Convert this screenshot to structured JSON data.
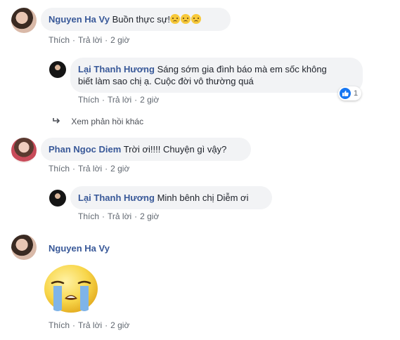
{
  "comments": [
    {
      "author": "Nguyen Ha Vy",
      "text": "Buồn thực sự!",
      "emoji": [
        "sad-face",
        "sad-face",
        "sad-face"
      ],
      "like": "Thích",
      "reply": "Trả lời",
      "time": "2 giờ"
    },
    {
      "author": "Lại Thanh Hương",
      "text_line1": "Sáng sớm gia đình báo mà em sốc không",
      "text_line2": "biết làm sao chị ạ. Cuộc đời vô thường quá",
      "reactions_count": "1",
      "like": "Thích",
      "reply": "Trả lời",
      "time": "2 giờ"
    },
    {
      "author": "Phan Ngoc Diem",
      "text": "Trời ơi!!!! Chuyện gì vậy?",
      "like": "Thích",
      "reply": "Trả lời",
      "time": "2 giờ"
    },
    {
      "author": "Lại Thanh Hương",
      "text": "Minh bênh chị Diễm ơi",
      "like": "Thích",
      "reply": "Trả lời",
      "time": "2 giờ"
    },
    {
      "author": "Nguyen Ha Vy",
      "sticker": "crying-face-sticker",
      "like": "Thích",
      "reply": "Trả lời",
      "time": "2 giờ"
    }
  ],
  "more_replies": "Xem phản hồi khác",
  "colors": {
    "name": "#385898",
    "bubble": "#f2f3f5",
    "meta": "#606770",
    "like": "#1877f2"
  }
}
